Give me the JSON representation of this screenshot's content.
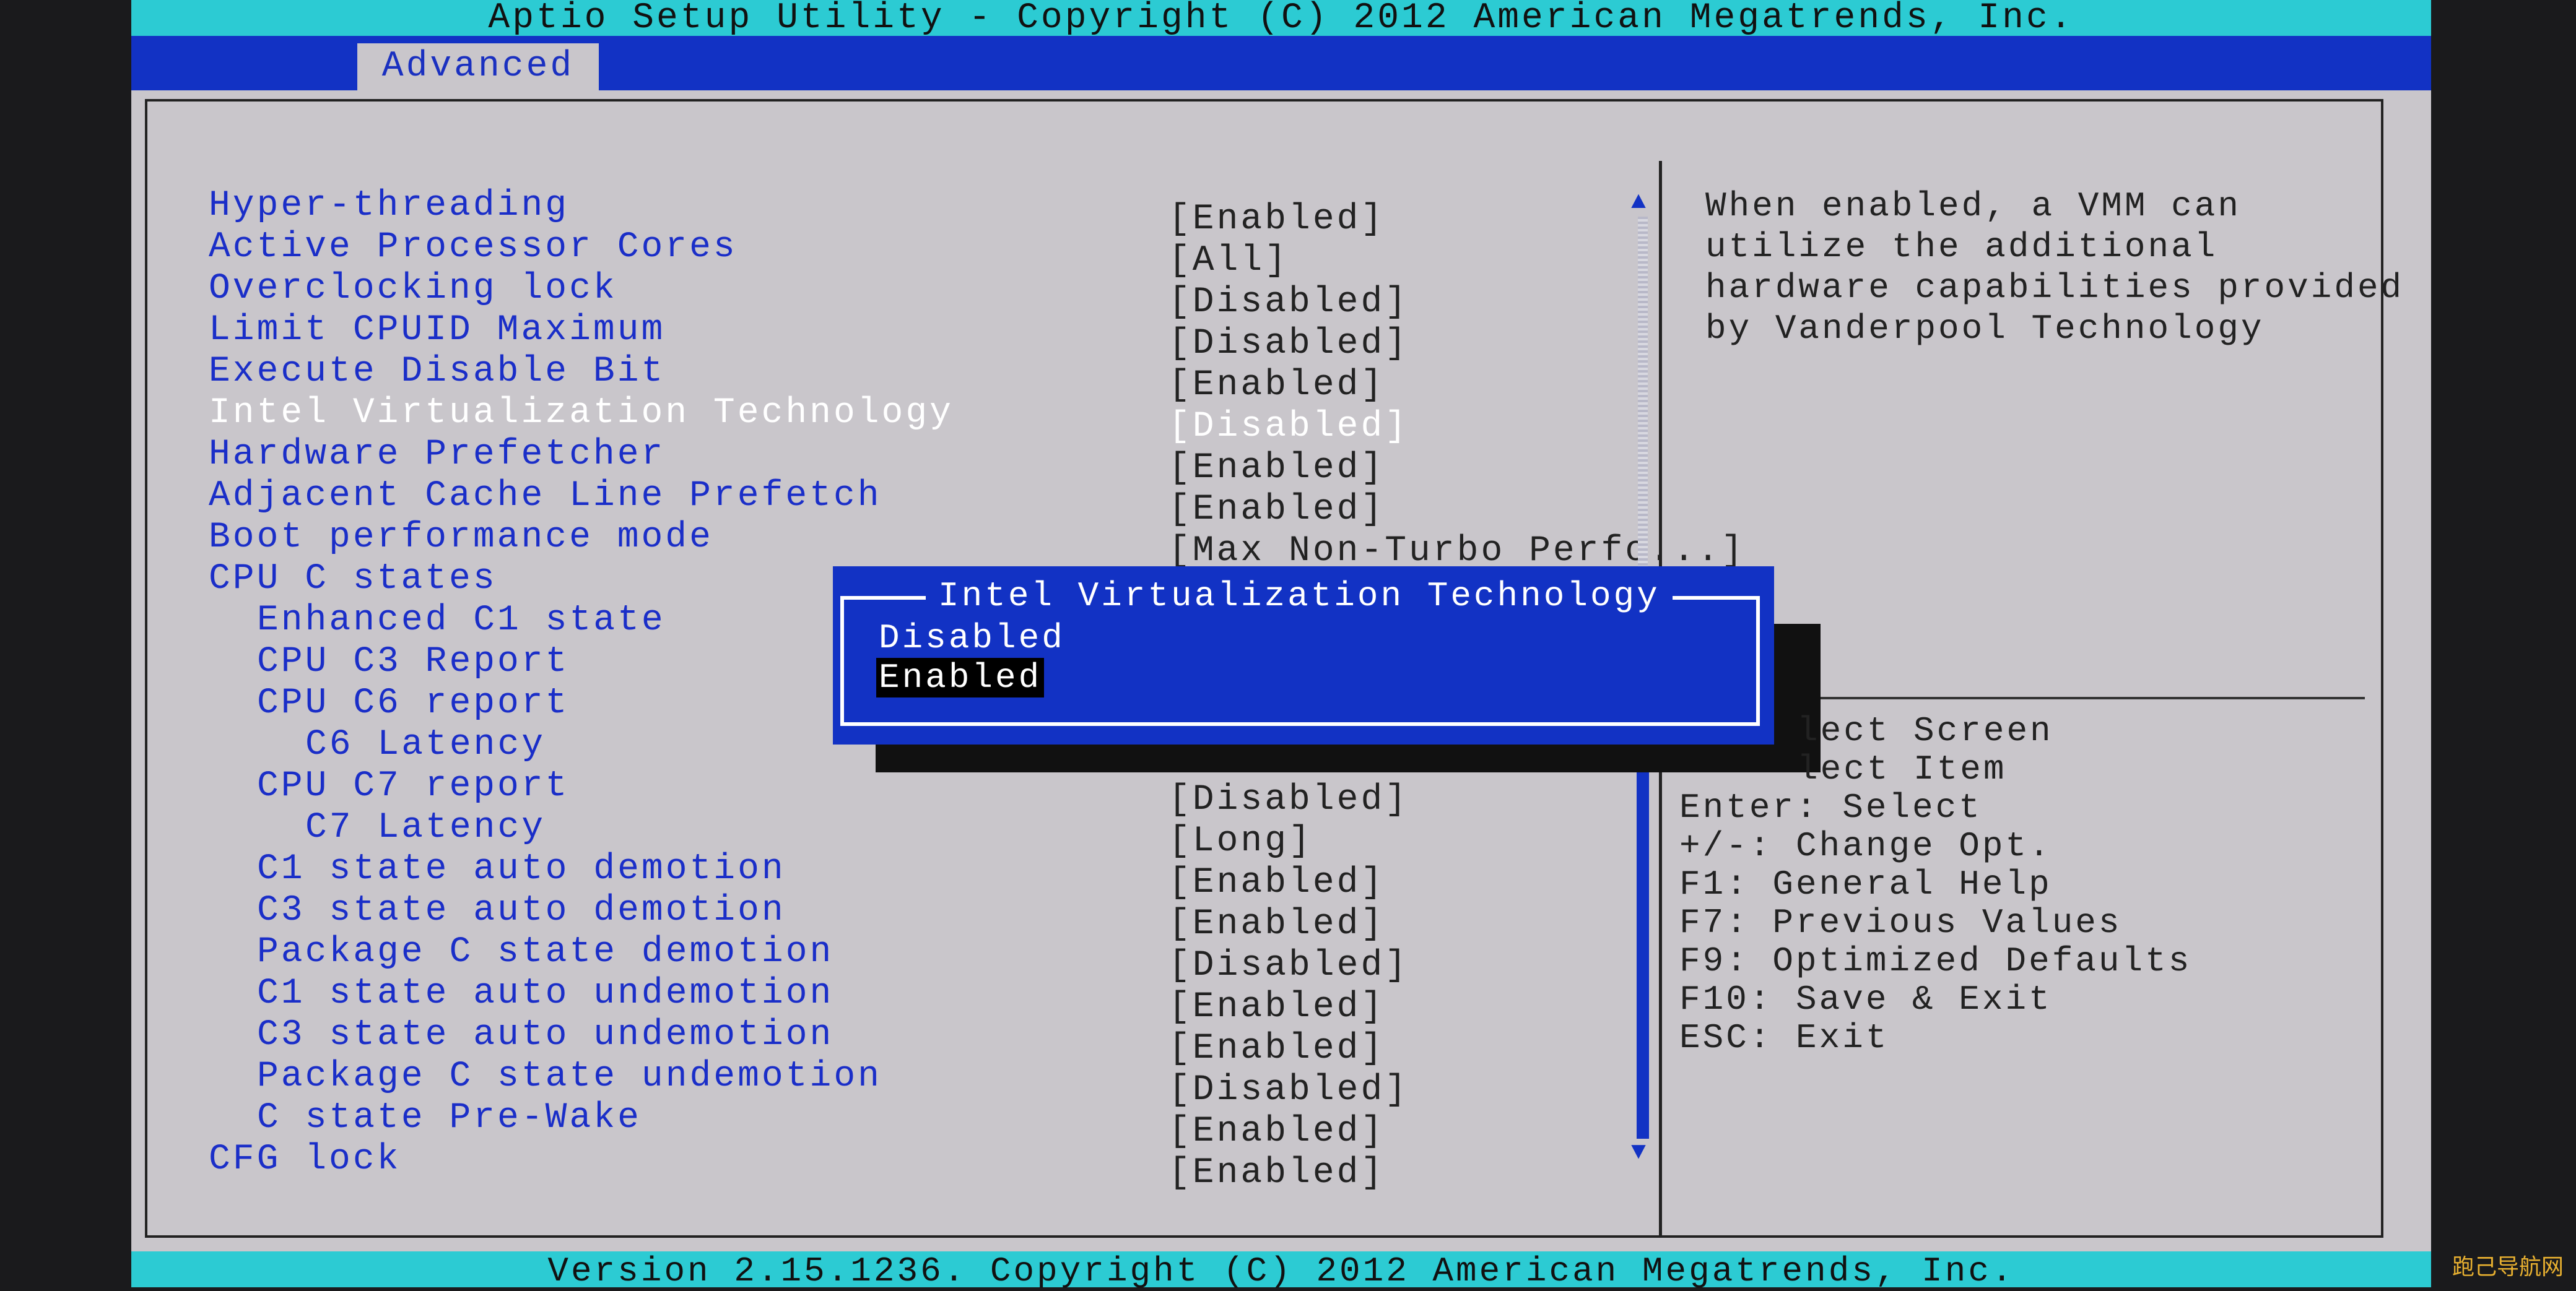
{
  "header": {
    "title": "Aptio Setup Utility - Copyright (C) 2012 American Megatrends, Inc."
  },
  "tabs": [
    {
      "label": "Advanced",
      "active": true
    }
  ],
  "settings": [
    {
      "label": "Hyper-threading",
      "value": "",
      "indent": 0
    },
    {
      "label": "Active Processor Cores",
      "value": "[Enabled]",
      "indent": 0
    },
    {
      "label": "Overclocking lock",
      "value": "[All]",
      "indent": 0
    },
    {
      "label": "Limit CPUID Maximum",
      "value": "[Disabled]",
      "indent": 0
    },
    {
      "label": "Execute Disable Bit",
      "value": "[Disabled]",
      "indent": 0
    },
    {
      "label": "Intel Virtualization Technology",
      "value": "[Enabled]",
      "indent": 0
    },
    {
      "label": "Hardware Prefetcher",
      "value": "[Disabled]",
      "indent": 0,
      "selected": true
    },
    {
      "label": "Adjacent Cache Line Prefetch",
      "value": "[Enabled]",
      "indent": 0
    },
    {
      "label": "Boot performance mode",
      "value": "[Enabled]",
      "indent": 0
    },
    {
      "label": "CPU C states",
      "value": "[Max Non-Turbo Perfo...]",
      "indent": 0
    },
    {
      "label": "Enhanced C1 state",
      "value": "",
      "indent": 1
    },
    {
      "label": "CPU C3 Report",
      "value": "",
      "indent": 1
    },
    {
      "label": "CPU C6 report",
      "value": "",
      "indent": 1
    },
    {
      "label": "C6 Latency",
      "value": "",
      "indent": 2
    },
    {
      "label": "CPU C7 report",
      "value": "",
      "indent": 1
    },
    {
      "label": "C7 Latency",
      "value": "[Disabled]",
      "indent": 2
    },
    {
      "label": "C1 state auto demotion",
      "value": "[Long]",
      "indent": 1
    },
    {
      "label": "C3 state auto demotion",
      "value": "[Enabled]",
      "indent": 1
    },
    {
      "label": "Package C state demotion",
      "value": "[Enabled]",
      "indent": 1
    },
    {
      "label": "C1 state auto undemotion",
      "value": "[Disabled]",
      "indent": 1
    },
    {
      "label": "C3 state auto undemotion",
      "value": "[Enabled]",
      "indent": 1
    },
    {
      "label": "Package C state undemotion",
      "value": "[Enabled]",
      "indent": 1
    },
    {
      "label": "C state Pre-Wake",
      "value": "[Disabled]",
      "indent": 1
    },
    {
      "label": "CFG lock",
      "value": "[Enabled]",
      "indent": 0
    },
    {
      "label": "",
      "value": "[Enabled]",
      "indent": 0
    }
  ],
  "help_text": "When enabled, a VMM can\nutilize the additional\nhardware capabilities provided\nby Vanderpool Technology",
  "keys": [
    "lect Screen",
    "lect Item",
    "Enter: Select",
    "+/-: Change Opt.",
    "F1: General Help",
    "F7: Previous Values",
    "F9: Optimized Defaults",
    "F10: Save & Exit",
    "ESC: Exit"
  ],
  "popup": {
    "title": "Intel Virtualization Technology",
    "options": [
      "Disabled",
      "Enabled"
    ],
    "selected": "Enabled"
  },
  "footer": {
    "version": "Version 2.15.1236. Copyright (C) 2012 American Megatrends, Inc."
  },
  "watermark": "跑己导航网",
  "colors": {
    "title_bar": "#2ccbd3",
    "accent_blue": "#1232c4",
    "panel_bg": "#c9c6cb",
    "label_text": "#1a2ec8"
  }
}
